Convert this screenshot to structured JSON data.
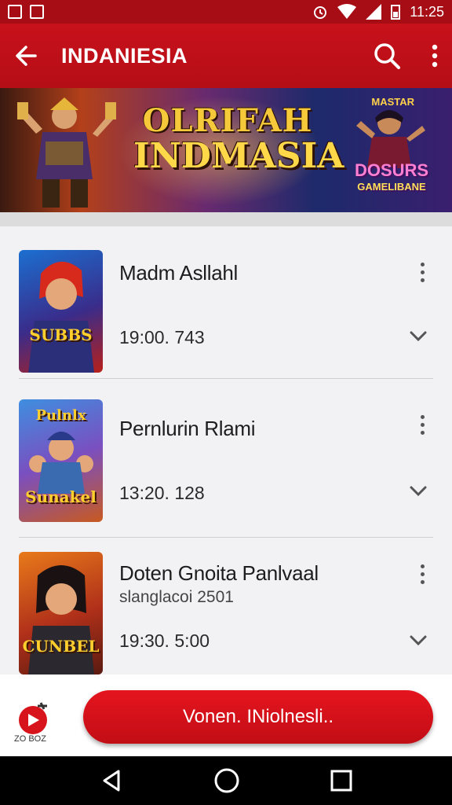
{
  "status_bar": {
    "time": "11:25"
  },
  "app_bar": {
    "title": "INDANIESIA"
  },
  "banner": {
    "title_line1": "OLRIFAH",
    "title_line2": "INDMASIA",
    "badge_line1": "DOSURS",
    "badge_line2": "GAMELIBANE",
    "corner_tag": "MASTAR"
  },
  "items": [
    {
      "title": "Madm Asllahl",
      "subtitle": "",
      "time": "19:00. 743",
      "thumb_label": "SUBBS",
      "thumb_colors": [
        "#1b6fd0",
        "#b8201a"
      ]
    },
    {
      "title": "Pernlurin Rlami",
      "subtitle": "",
      "time": "13:20. 128",
      "thumb_label": "Sunakel",
      "thumb_colors": [
        "#3e8fe0",
        "#c85a20"
      ]
    },
    {
      "title": "Doten Gnoita Panlvaal",
      "subtitle": "slanglacoi 2501",
      "time": "19:30. 5:00",
      "thumb_label": "CUNBEL",
      "thumb_colors": [
        "#e87a1a",
        "#5a1a10"
      ]
    }
  ],
  "bottom": {
    "cta_label": "Vonen. INiolnesli..",
    "brand_text": "ZO BOZ"
  },
  "colors": {
    "primary": "#c8111b",
    "status": "#a70d14"
  }
}
